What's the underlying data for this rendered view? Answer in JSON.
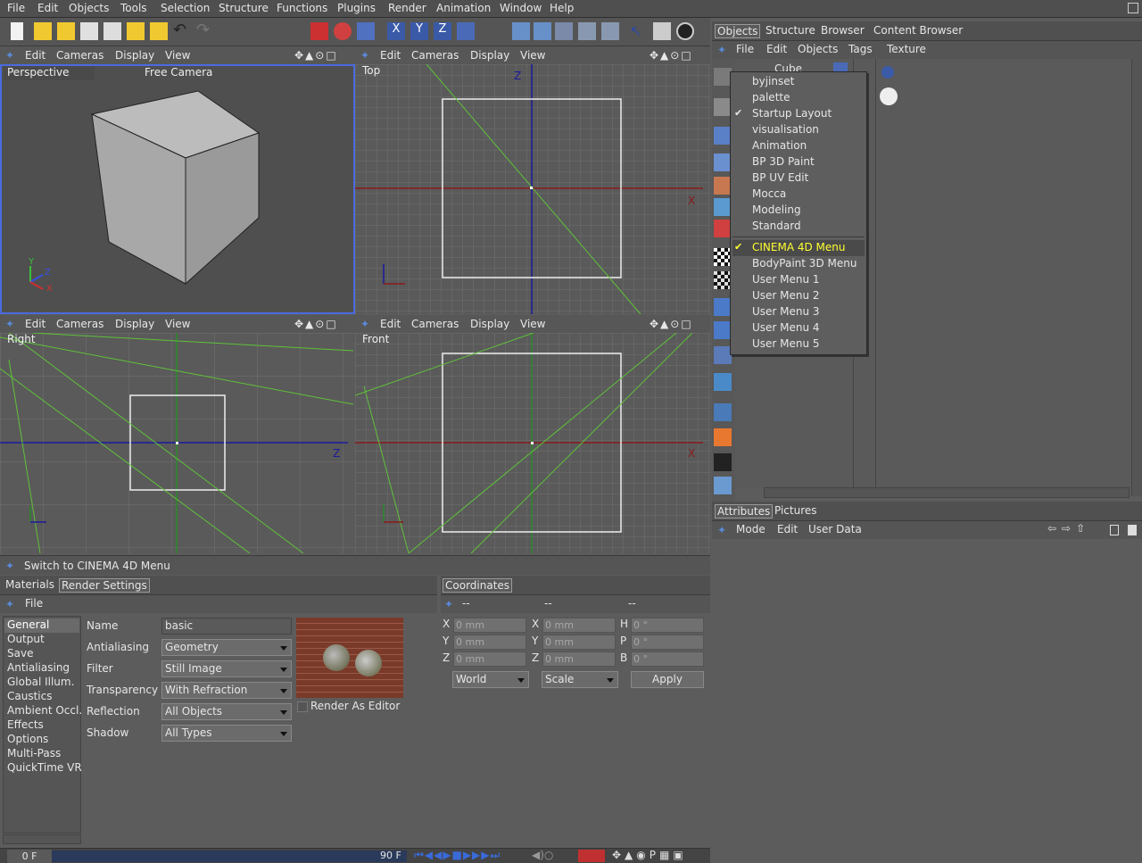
{
  "main_menu": [
    "File",
    "Edit",
    "Objects",
    "Tools",
    "Selection",
    "Structure",
    "Functions",
    "Plugins",
    "Render",
    "Animation",
    "Window",
    "Help"
  ],
  "viewports": {
    "menu": [
      "Edit",
      "Cameras",
      "Display",
      "View"
    ],
    "perspective": {
      "name": "Perspective",
      "camera": "Free Camera"
    },
    "top": {
      "name": "Top"
    },
    "right": {
      "name": "Right"
    },
    "front": {
      "name": "Front"
    }
  },
  "axis": {
    "x": "X",
    "y": "Y",
    "z": "Z"
  },
  "status": "Switch to CINEMA 4D Menu",
  "objects_panel": {
    "tabs": [
      "Objects",
      "Structure",
      "Browser",
      "Content Browser"
    ],
    "menu": [
      "File",
      "Edit",
      "Objects",
      "Tags",
      "Texture"
    ],
    "object_name": "Cube"
  },
  "layout_menu": {
    "items": [
      "byjinset",
      "palette",
      "Startup Layout",
      "visualisation",
      "Animation",
      "BP 3D Paint",
      "BP UV Edit",
      "Mocca",
      "Modeling",
      "Standard"
    ],
    "menus": [
      "CINEMA 4D Menu",
      "BodyPaint 3D Menu",
      "User Menu 1",
      "User Menu 2",
      "User Menu 3",
      "User Menu 4",
      "User Menu 5"
    ],
    "checked_layout": "Startup Layout",
    "checked_menu": "CINEMA 4D Menu"
  },
  "attributes_panel": {
    "tabs": [
      "Attributes",
      "Pictures"
    ],
    "menu": [
      "Mode",
      "Edit",
      "User Data"
    ]
  },
  "materials_panel": {
    "tabs": [
      "Materials",
      "Render Settings"
    ],
    "menu": "File"
  },
  "render_settings": {
    "categories": [
      "General",
      "Output",
      "Save",
      "Antialiasing",
      "Global Illum.",
      "Caustics",
      "Ambient Occl.",
      "Effects",
      "Options",
      "Multi-Pass",
      "QuickTime VR"
    ],
    "selected": "General",
    "fields": [
      {
        "label": "Name",
        "value": "basic"
      },
      {
        "label": "Antialiasing",
        "value": "Geometry"
      },
      {
        "label": "Filter",
        "value": "Still Image"
      },
      {
        "label": "Transparency",
        "value": "With Refraction"
      },
      {
        "label": "Reflection",
        "value": "All Objects"
      },
      {
        "label": "Shadow",
        "value": "All Types"
      }
    ],
    "render_as_editor": "Render As Editor"
  },
  "coordinates": {
    "tab": "Coordinates",
    "headers": [
      "--",
      "--",
      "--"
    ],
    "pos": [
      {
        "axis": "X",
        "value": "0 mm"
      },
      {
        "axis": "Y",
        "value": "0 mm"
      },
      {
        "axis": "Z",
        "value": "0 mm"
      }
    ],
    "scale": [
      {
        "axis": "X",
        "value": "0 mm"
      },
      {
        "axis": "Y",
        "value": "0 mm"
      },
      {
        "axis": "Z",
        "value": "0 mm"
      }
    ],
    "rot": [
      {
        "axis": "H",
        "value": "0 °"
      },
      {
        "axis": "P",
        "value": "0 °"
      },
      {
        "axis": "B",
        "value": "0 °"
      }
    ],
    "mode1": "World",
    "mode2": "Scale",
    "apply": "Apply"
  },
  "timeline": {
    "start": "0 F",
    "end": "90 F"
  },
  "colors": {
    "grid_bg": "#5a5a5a",
    "grid_line": "#6e6e6e",
    "accent_menu": "#ffff33",
    "green_line": "#5fc23a"
  }
}
